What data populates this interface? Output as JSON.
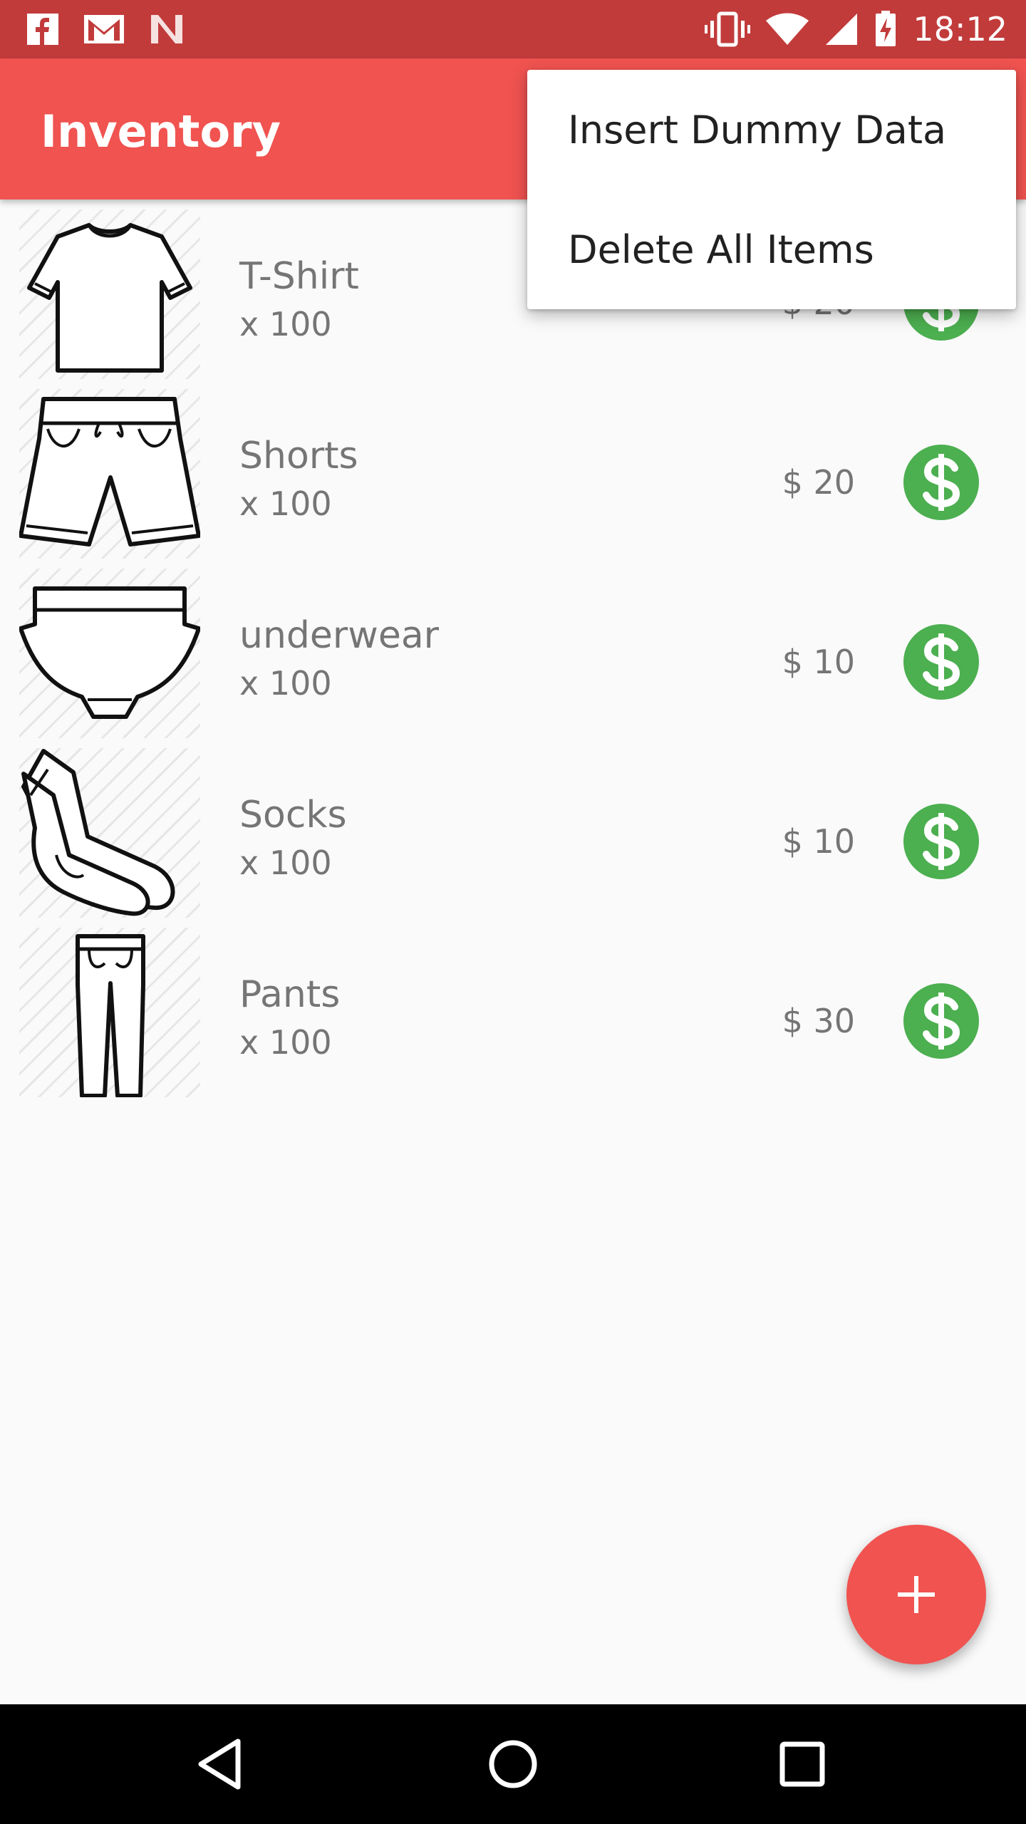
{
  "status_bar": {
    "time": "18:12",
    "left_icons": [
      "facebook-icon",
      "gmail-icon",
      "n-icon"
    ],
    "right_icons": [
      "vibrate-icon",
      "wifi-icon",
      "signal-icon",
      "battery-charging-icon"
    ]
  },
  "app_bar": {
    "title": "Inventory",
    "color": "#f05350"
  },
  "menu": {
    "items": [
      {
        "label": "Insert Dummy Data"
      },
      {
        "label": "Delete All Items"
      }
    ]
  },
  "items": [
    {
      "name": "T-Shirt",
      "qty": "x 100",
      "price": "$ 20",
      "icon": "tshirt-icon"
    },
    {
      "name": "Shorts",
      "qty": "x 100",
      "price": "$ 20",
      "icon": "shorts-icon"
    },
    {
      "name": "underwear",
      "qty": "x 100",
      "price": "$ 10",
      "icon": "underwear-icon"
    },
    {
      "name": "Socks",
      "qty": "x 100",
      "price": "$ 10",
      "icon": "socks-icon"
    },
    {
      "name": "Pants",
      "qty": "x 100",
      "price": "$ 30",
      "icon": "pants-icon"
    }
  ],
  "fab": {
    "icon": "plus-icon"
  },
  "nav_bar": {
    "buttons": [
      "back-icon",
      "home-icon",
      "recents-icon"
    ]
  },
  "colors": {
    "accent": "#f05350",
    "status_bar": "#c23b3b",
    "buy_button": "#4caf50"
  }
}
